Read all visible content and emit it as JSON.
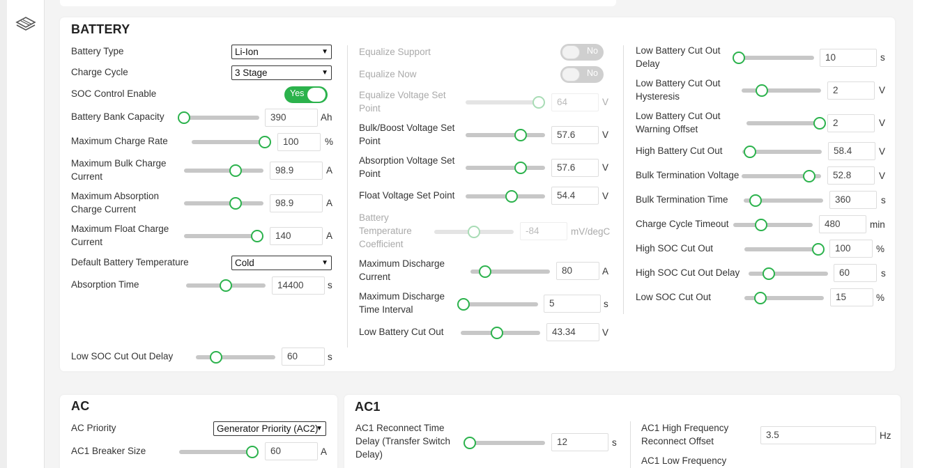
{
  "sidebar": {
    "logo_icon": "stacked-layers-icon"
  },
  "battery": {
    "title": "BATTERY",
    "battery_type": {
      "label": "Battery Type",
      "value": "Li-Ion"
    },
    "charge_cycle": {
      "label": "Charge Cycle",
      "value": "3 Stage"
    },
    "soc_control": {
      "label": "SOC Control Enable",
      "state": "Yes"
    },
    "bank_capacity": {
      "label": "Battery Bank Capacity",
      "value": "390",
      "unit": "Ah",
      "level": 0.05
    },
    "max_charge_rate": {
      "label": "Maximum Charge Rate",
      "value": "100",
      "unit": "%",
      "level": 0.92
    },
    "max_bulk_current": {
      "label": "Maximum Bulk Charge Current",
      "value": "98.9",
      "unit": "A",
      "level": 0.65
    },
    "max_absorption_current": {
      "label": "Maximum Absorption Charge Current",
      "value": "98.9",
      "unit": "A",
      "level": 0.65
    },
    "max_float_current": {
      "label": "Maximum Float Charge Current",
      "value": "140",
      "unit": "A",
      "level": 0.92
    },
    "default_temp": {
      "label": "Default Battery Temperature",
      "value": "Cold"
    },
    "absorption_time": {
      "label": "Absorption Time",
      "value": "14400",
      "unit": "s",
      "level": 0.5
    },
    "low_soc_delay": {
      "label": "Low SOC Cut Out Delay",
      "value": "60",
      "unit": "s",
      "level": 0.25
    },
    "equalize_support": {
      "label": "Equalize Support",
      "state": "No"
    },
    "equalize_now": {
      "label": "Equalize Now",
      "state": "No"
    },
    "equalize_voltage": {
      "label": "Equalize Voltage Set Point",
      "value": "64",
      "unit": "V",
      "level": 0.92
    },
    "bulk_voltage": {
      "label": "Bulk/Boost Voltage Set Point",
      "value": "57.6",
      "unit": "V",
      "level": 0.69
    },
    "absorption_voltage": {
      "label": "Absorption Voltage Set Point",
      "value": "57.6",
      "unit": "V",
      "level": 0.69
    },
    "float_voltage": {
      "label": "Float Voltage Set Point",
      "value": "54.4",
      "unit": "V",
      "level": 0.58
    },
    "temp_coeff": {
      "label": "Battery Temperature Coefficient",
      "value": "-84",
      "unit": "mV/degC",
      "level": 0.5
    },
    "max_discharge_current": {
      "label": "Maximum Discharge Current",
      "value": "80",
      "unit": "A",
      "level": 0.18
    },
    "max_discharge_interval": {
      "label": "Maximum Discharge Time Interval",
      "value": "5",
      "unit": "s",
      "level": 0.0
    },
    "low_battery_cutout": {
      "label": "Low Battery Cut Out",
      "value": "43.34",
      "unit": "V",
      "level": 0.46
    },
    "low_batt_delay": {
      "label": "Low Battery Cut Out Delay",
      "value": "10",
      "unit": "s",
      "level": 0.05
    },
    "low_batt_hysteresis": {
      "label": "Low Battery Cut Out Hysteresis",
      "value": "2",
      "unit": "V",
      "level": 0.25
    },
    "low_batt_warning": {
      "label": "Low Battery Cut Out Warning Offset",
      "value": "2",
      "unit": "V",
      "level": 0.98
    },
    "high_batt_cutout": {
      "label": "High Battery Cut Out",
      "value": "58.4",
      "unit": "V",
      "level": 0.1
    },
    "bulk_term_voltage": {
      "label": "Bulk Termination Voltage",
      "value": "52.8",
      "unit": "V",
      "level": 0.85
    },
    "bulk_term_time": {
      "label": "Bulk Termination Time",
      "value": "360",
      "unit": "s",
      "level": 0.15
    },
    "charge_cycle_timeout": {
      "label": "Charge Cycle Timeout",
      "value": "480",
      "unit": "min",
      "level": 0.35
    },
    "high_soc_cutout": {
      "label": "High SOC Cut Out",
      "value": "100",
      "unit": "%",
      "level": 0.98
    },
    "high_soc_delay": {
      "label": "High SOC Cut Out Delay",
      "value": "60",
      "unit": "s",
      "level": 0.25
    },
    "low_soc_cutout": {
      "label": "Low SOC Cut Out",
      "value": "15",
      "unit": "%",
      "level": 0.2
    }
  },
  "ac": {
    "title": "AC",
    "priority": {
      "label": "AC Priority",
      "value": "Generator Priority (AC2)"
    },
    "breaker": {
      "label": "AC1 Breaker Size",
      "value": "60",
      "unit": "A",
      "level": 0.92
    }
  },
  "ac1": {
    "title": "AC1",
    "reconnect_delay": {
      "label": "AC1 Reconnect Time Delay (Transfer Switch Delay)",
      "value": "12",
      "unit": "s",
      "level": 0.05
    },
    "high_freq": {
      "label": "AC1 High Frequency Reconnect Offset",
      "value": "3.5",
      "unit": "Hz"
    },
    "low_freq": {
      "label": "AC1 Low Frequency"
    }
  }
}
